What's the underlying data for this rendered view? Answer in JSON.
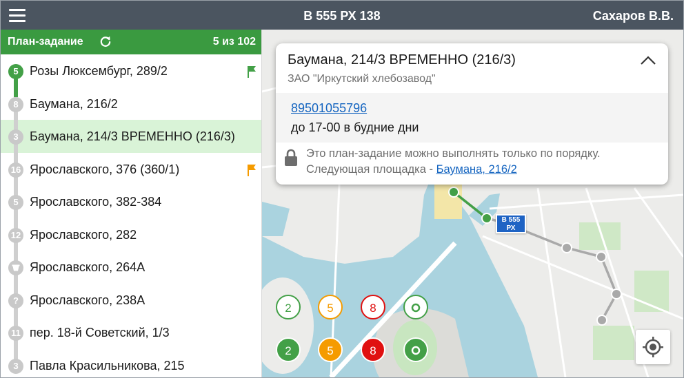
{
  "header": {
    "vehicle_title": "В 555 РХ 138",
    "user_name": "Сахаров В.В."
  },
  "sidebar": {
    "title": "План-задание",
    "count": "5 из 102",
    "items": [
      {
        "number": "5",
        "label": "Розы Люксембург, 289/2",
        "flag": "green"
      },
      {
        "number": "8",
        "label": "Баумана, 216/2"
      },
      {
        "number": "3",
        "label": "Баумана, 214/3 ВРЕМЕННО (216/3)"
      },
      {
        "number": "16",
        "label": "Ярославского, 376 (360/1)",
        "flag": "orange"
      },
      {
        "number": "5",
        "label": "Ярославского, 382-384"
      },
      {
        "number": "12",
        "label": "Ярославского, 282"
      },
      {
        "number": "",
        "label": "Ярославского, 264А"
      },
      {
        "number": "?",
        "label": "Ярославского, 238А"
      },
      {
        "number": "11",
        "label": "пер. 18-й Советский, 1/3"
      },
      {
        "number": "3",
        "label": "Павла Красильникова, 215"
      }
    ]
  },
  "card": {
    "title": "Баумана, 214/3 ВРЕМЕННО (216/3)",
    "subtitle": "ЗАО \"Иркутский хлебозавод\"",
    "phone": "89501055796",
    "hours": "до 17-00 в будние дни",
    "notice_line1": "Это план-задание можно выполнять только по порядку.",
    "notice_line2_prefix": "Следующая площадка - ",
    "notice_link": "Баумана, 216/2"
  },
  "vehicle_marker": {
    "line1": "В 555",
    "line2": "РХ"
  },
  "clusters": {
    "outline": [
      {
        "label": "2",
        "color": "#43a047"
      },
      {
        "label": "5",
        "color": "#f59b00"
      },
      {
        "label": "8",
        "color": "#e01010"
      },
      {
        "label": "",
        "color": "#43a047"
      }
    ],
    "filled": [
      {
        "label": "2",
        "color": "#43a047"
      },
      {
        "label": "5",
        "color": "#f59b00"
      },
      {
        "label": "8",
        "color": "#e01010"
      },
      {
        "label": "",
        "color": "#43a047"
      }
    ]
  },
  "colors": {
    "header_bg": "#4b5560",
    "sidebar_header_bg": "#3a9a40",
    "active_row_bg": "#d9f3d7",
    "link": "#1565c0",
    "route_done": "#43a047",
    "route_pending": "#a9a9a9"
  },
  "icons": {
    "menu": "hamburger-icon",
    "refresh": "refresh-icon",
    "collapse": "chevron-up-icon",
    "lock": "lock-icon",
    "locate": "my-location-icon"
  }
}
